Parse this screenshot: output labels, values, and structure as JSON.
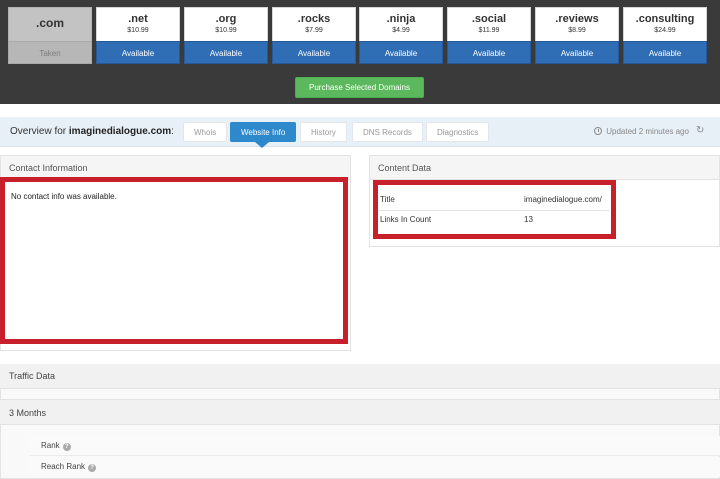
{
  "domains": [
    {
      "tld": ".com",
      "price": "",
      "status": "Taken"
    },
    {
      "tld": ".net",
      "price": "$10.99",
      "status": "Available"
    },
    {
      "tld": ".org",
      "price": "$10.99",
      "status": "Available"
    },
    {
      "tld": ".rocks",
      "price": "$7.99",
      "status": "Available"
    },
    {
      "tld": ".ninja",
      "price": "$4.99",
      "status": "Available"
    },
    {
      "tld": ".social",
      "price": "$11.99",
      "status": "Available"
    },
    {
      "tld": ".reviews",
      "price": "$8.99",
      "status": "Available"
    },
    {
      "tld": ".consulting",
      "price": "$24.99",
      "status": "Available"
    }
  ],
  "purchase_button": "Purchase Selected Domains",
  "overview": {
    "prefix": "Overview for",
    "domain": "imaginedialogue.com",
    "suffix": ":",
    "tabs": [
      "Whois",
      "Website Info",
      "History",
      "DNS Records",
      "Diagnostics"
    ],
    "active_tab": "Website Info",
    "updated": "Updated 2 minutes ago"
  },
  "contact": {
    "header": "Contact Information",
    "message": "No contact info was available."
  },
  "content_data": {
    "header": "Content Data",
    "rows": [
      {
        "key": "Title",
        "value": "imaginedialogue.com/"
      },
      {
        "key": "Links In Count",
        "value": "13"
      }
    ]
  },
  "traffic": {
    "header": "Traffic Data",
    "period": "3 Months",
    "metrics": [
      "Rank",
      "Reach Rank"
    ]
  },
  "colors": {
    "accent_blue": "#2d88cc",
    "status_blue": "#2f6db5",
    "purchase_green": "#5cb85c",
    "highlight_red": "#c8202a"
  }
}
